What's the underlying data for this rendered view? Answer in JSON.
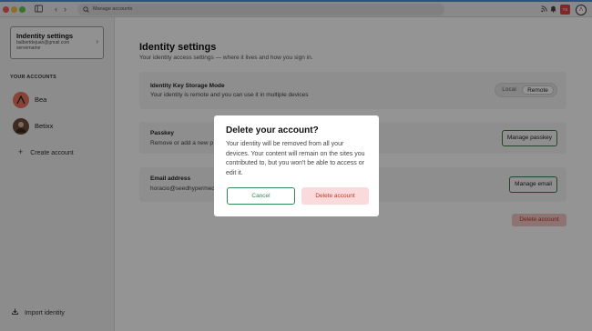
{
  "topbar": {
    "search_placeholder": "Manage accounts",
    "user_badge": "TS",
    "icons": [
      "sidebar-toggle-icon",
      "back-icon",
      "forward-icon",
      "search-icon",
      "rss-icon",
      "bell-icon",
      "account-avatar-icon"
    ]
  },
  "sidebar": {
    "identity_card": {
      "title": "Indentity settings",
      "email": "balbertdejuan@gmail.com",
      "server": "servername"
    },
    "accounts_header": "YOUR ACCOUNTS",
    "accounts": [
      {
        "name": "Bea",
        "color": "#e8745f"
      },
      {
        "name": "Betixx",
        "color": "#6b4c3b"
      }
    ],
    "create_account": "Create account",
    "import_identity": "Import identity"
  },
  "main": {
    "title": "Identity settings",
    "subtitle": "Your identity access settings — where it lives and how you sign in.",
    "storage": {
      "title": "Identity Key Storage Mode",
      "desc": "Your identity is remote and you can use it in multiple devices",
      "options": [
        "Local",
        "Remote"
      ],
      "selected": "Remote"
    },
    "passkey": {
      "title": "Passkey",
      "desc": "Remove or add a new p",
      "button": "Manage passkey"
    },
    "email": {
      "title": "Email address",
      "value": "horacio@seedhypermed",
      "button": "Manage email"
    },
    "delete_button": "Delete account"
  },
  "dialog": {
    "title": "Delete your account?",
    "body": "Your identity will be removed from all your devices. Your content will remain on the sites you contributed to, but you won't be able to access or edit it.",
    "cancel": "Cancel",
    "confirm": "Delete account"
  },
  "colors": {
    "accent": "#2f8a55",
    "danger": "#c0392b",
    "danger_bg": "#fadada",
    "overlay": "rgba(0,0,0,0.42)"
  }
}
